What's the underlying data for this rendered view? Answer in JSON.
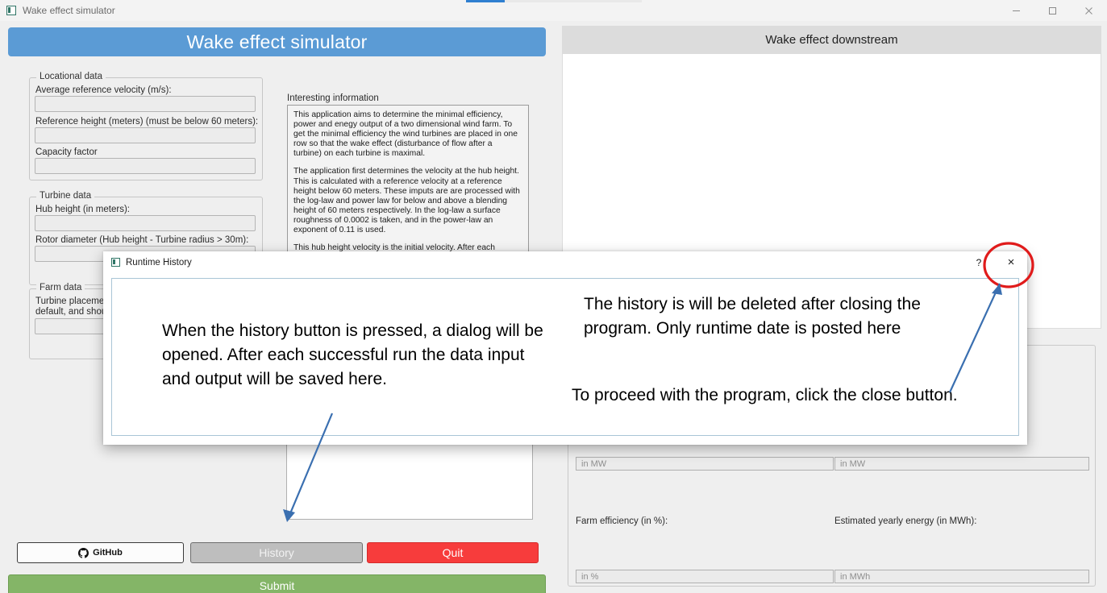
{
  "window": {
    "title": "Wake effect simulator",
    "controls": {
      "minimize": "minimize-icon",
      "maximize": "maximize-icon",
      "close": "close-icon"
    }
  },
  "app": {
    "banner_title": "Wake effect simulator"
  },
  "left_panel": {
    "groups": [
      {
        "title": "Locational data",
        "fields": [
          {
            "label": "Average reference velocity (m/s):",
            "value": "",
            "placeholder": ""
          },
          {
            "label": "Reference height (meters) (must be below 60 meters):",
            "value": "",
            "placeholder": ""
          },
          {
            "label": "Capacity factor",
            "value": "",
            "placeholder": ""
          }
        ]
      },
      {
        "title": "Turbine data",
        "fields": [
          {
            "label": "Hub height (in meters):",
            "value": "",
            "placeholder": ""
          },
          {
            "label": "Rotor diameter (Hub height - Turbine radius > 30m):",
            "value": "",
            "placeholder": ""
          }
        ]
      },
      {
        "title": "Farm data",
        "fields": [
          {
            "label": "Turbine placement (as\ndefault, and should no",
            "value": "",
            "placeholder": ""
          }
        ]
      }
    ],
    "info": {
      "label": "Interesting information",
      "paragraphs": [
        "This application aims to determine the minimal efficiency, power and enegy output of a two dimensional wind farm. To get the minimal efficiency the wind turbines are placed in one row so that the wake effect (disturbance of flow after a turbine) on each turbine is maximal.",
        "The application first determines the velocity at the hub height. This is calculated with a reference velocity at a reference height below 60 meters. These imputs are are processed with the log-law and power law for below and above a blending height of 60 meters respectively. In the log-law a surface roughness of 0.0002 is taken, and in the power-law an exponent of 0.11 is used.",
        "This hub height velocity is the initial velocity. After each turbine that is placed, the velocity decreases according to the Jensen model. The effect of velocity is translated to the power yield of the array of wind turbines. In the Jensen model it is required that all wind turbines have minimal spacing of 3 turbine rotor diameters. The assumption is made that the wake expansion factor is 0.05."
      ]
    },
    "buttons": {
      "github": "GitHub",
      "history": "History",
      "quit": "Quit",
      "submit": "Submit"
    }
  },
  "right_panel": {
    "plot_title": "Wake effect downstream",
    "results": [
      {
        "label": "",
        "placeholder": "in MW"
      },
      {
        "label": "",
        "placeholder": "in MW"
      },
      {
        "label": "Farm efficiency (in %):",
        "placeholder": "in %"
      },
      {
        "label": "Estimated yearly energy (in MWh):",
        "placeholder": "in MWh"
      }
    ]
  },
  "dialog": {
    "title": "Runtime History",
    "help_label": "?",
    "close_label": "×",
    "annotations": {
      "left": "When the history button is pressed, a dialog will be opened. After each successful run the data input and output  will be saved here.",
      "right_top": "The history is will be deleted after closing the program. Only runtime date is posted here",
      "right_bottom": "To proceed with the program, click the close button."
    }
  },
  "colors": {
    "banner_blue": "#5b9bd5",
    "quit_red": "#f73c3c",
    "submit_green": "#84b567",
    "history_gray": "#bebebe",
    "annotation_arrow_blue": "#3a6fb0",
    "highlight_circle_red": "#e01b1b"
  }
}
